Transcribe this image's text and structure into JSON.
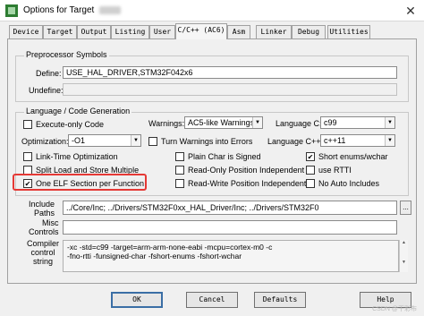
{
  "window": {
    "title": "Options for Target",
    "close_glyph": "✕"
  },
  "tabs": [
    "Device",
    "Target",
    "Output",
    "Listing",
    "User",
    "C/C++ (AC6)",
    "Asm",
    "Linker",
    "Debug",
    "Utilities"
  ],
  "active_tab": "C/C++ (AC6)",
  "preprocessor": {
    "title": "Preprocessor Symbols",
    "define_label": "Define:",
    "define_value": "USE_HAL_DRIVER,STM32F042x6",
    "undefine_label": "Undefine:",
    "undefine_value": ""
  },
  "language": {
    "title": "Language / Code Generation",
    "execute_only": {
      "label": "Execute-only Code",
      "checked": false
    },
    "optimization_label": "Optimization:",
    "optimization_value": "-O1",
    "link_time": {
      "label": "Link-Time Optimization",
      "checked": false
    },
    "split_load": {
      "label": "Split Load and Store Multiple",
      "checked": false
    },
    "one_elf": {
      "label": "One ELF Section per Function",
      "checked": true
    },
    "warnings_label": "Warnings:",
    "warnings_value": "AC5-like Warnings",
    "turn_warnings": {
      "label": "Turn Warnings into Errors",
      "checked": false
    },
    "plain_char": {
      "label": "Plain Char is Signed",
      "checked": false
    },
    "readonly_pi": {
      "label": "Read-Only Position Independent",
      "checked": false
    },
    "readwrite_pi": {
      "label": "Read-Write Position Independent",
      "checked": false
    },
    "lang_c_label": "Language C:",
    "lang_c_value": "c99",
    "lang_cpp_label": "Language C++:",
    "lang_cpp_value": "c++11",
    "short_enums": {
      "label": "Short enums/wchar",
      "checked": true
    },
    "use_rtti": {
      "label": "use RTTI",
      "checked": false
    },
    "no_auto": {
      "label": "No Auto Includes",
      "checked": false
    }
  },
  "include": {
    "label_line1": "Include",
    "label_line2": "Paths",
    "value": "../Core/Inc;                          ../Drivers/STM32F0xx_HAL_Driver/Inc;                 ../Drivers/STM32F0",
    "browse": "..."
  },
  "misc": {
    "label_line1": "Misc",
    "label_line2": "Controls",
    "value": ""
  },
  "compiler": {
    "label_line1": "Compiler",
    "label_line2": "control",
    "label_line3": "string",
    "line1": "-xc -std=c99 -target=arm-arm-none-eabi -mcpu=cortex-m0 -c",
    "line2": "-fno-rtti -funsigned-char -fshort-enums -fshort-wchar"
  },
  "buttons": {
    "ok": "OK",
    "cancel": "Cancel",
    "defaults": "Defaults",
    "help": "Help"
  },
  "watermark": "CSDN @干彩布"
}
